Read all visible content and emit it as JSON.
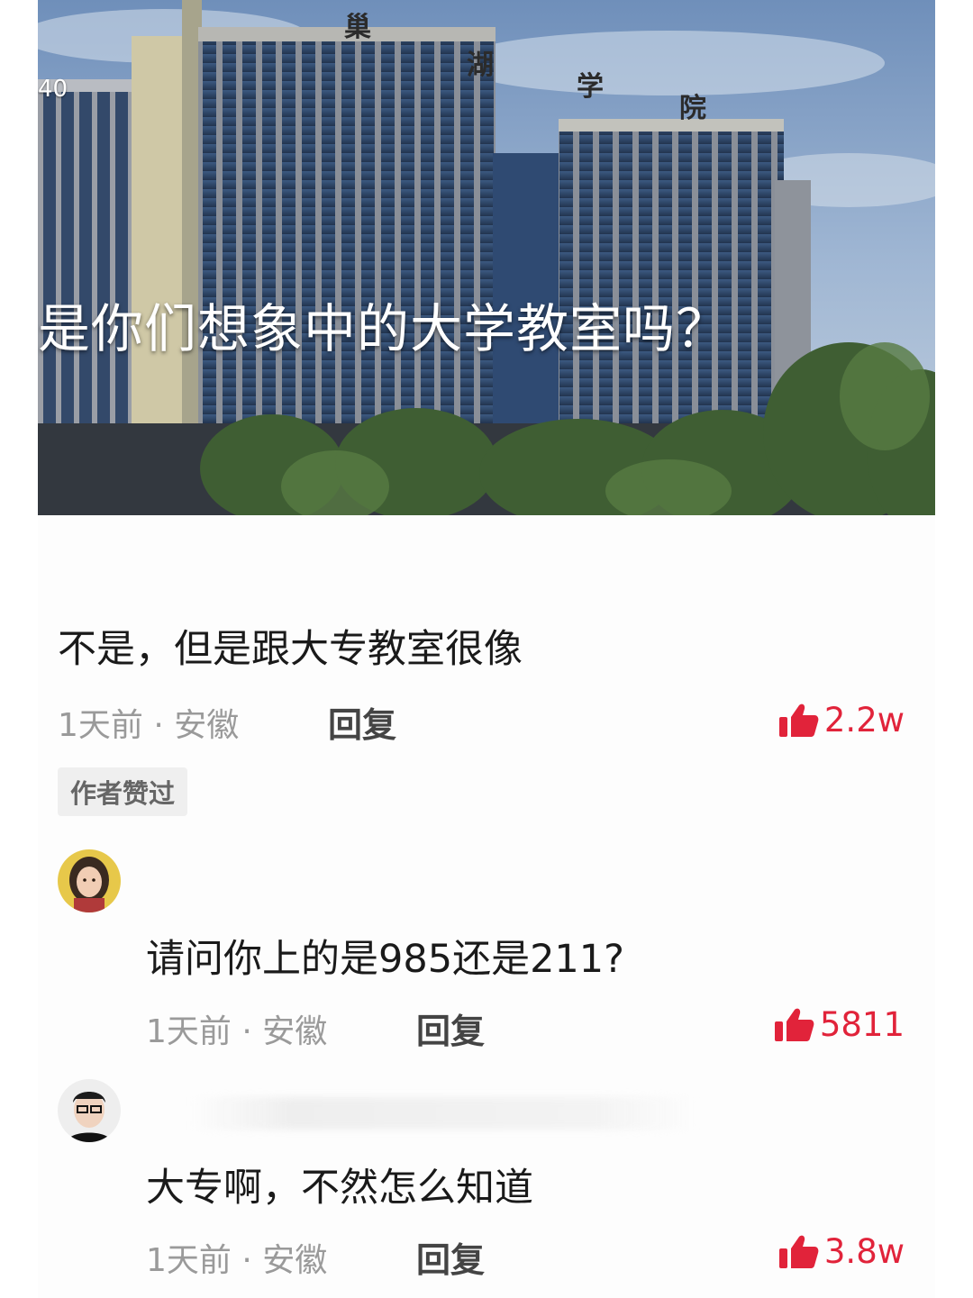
{
  "hero": {
    "counter": "40",
    "caption": "是你们想象中的大学教室吗？",
    "sign_chars": [
      "巢",
      "湖",
      "学",
      "院"
    ]
  },
  "comments": [
    {
      "text": "不是，但是跟大专教室很像",
      "meta": "1天前 · 安徽",
      "reply_label": "回复",
      "likes": "2.2w",
      "badge": "作者赞过"
    },
    {
      "text": "请问你上的是985还是211?",
      "meta": "1天前 · 安徽",
      "reply_label": "回复",
      "likes": "5811"
    },
    {
      "text": "大专啊，不然怎么知道",
      "meta": "1天前 · 安徽",
      "reply_label": "回复",
      "likes": "3.8w"
    }
  ],
  "colors": {
    "like": "#e1233a",
    "meta": "#9a9a9a",
    "text": "#1a1a1a"
  },
  "icons": {
    "like": "thumbs-up-icon"
  }
}
